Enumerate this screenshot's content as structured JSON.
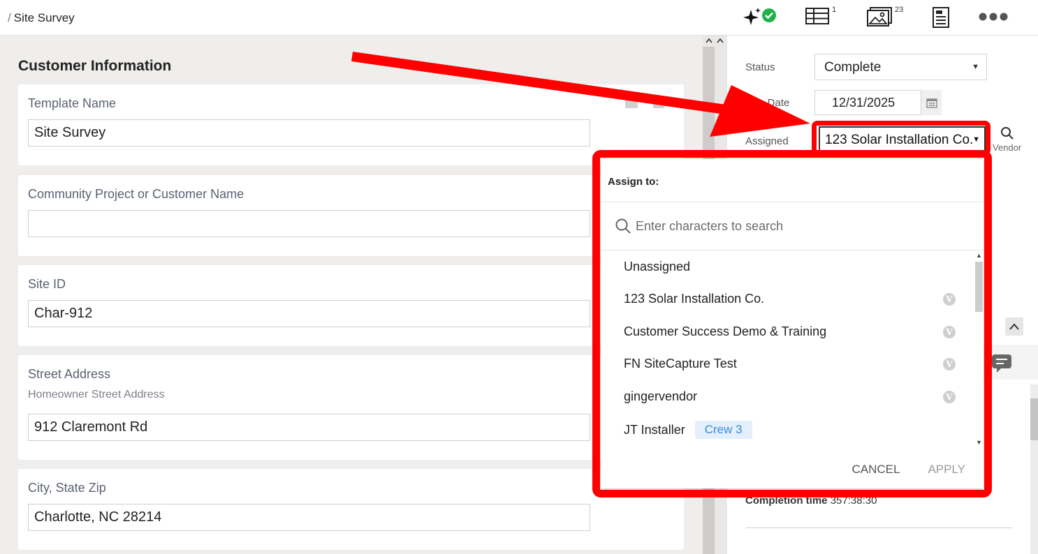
{
  "topbar": {
    "breadcrumb_sep": "/",
    "breadcrumb": "Site Survey",
    "tables_count": "1",
    "photos_count": "23"
  },
  "form": {
    "section_title": "Customer Information",
    "fields": [
      {
        "label": "Template Name",
        "value": "Site Survey"
      },
      {
        "label": "Community Project or Customer Name",
        "value": ""
      },
      {
        "label": "Site ID",
        "value": "Char-912"
      },
      {
        "label": "Street Address",
        "sublabel": "Homeowner Street Address",
        "value": "912 Claremont Rd"
      },
      {
        "label": "City, State Zip",
        "value": "Charlotte, NC 28214"
      }
    ]
  },
  "details": {
    "status_label": "Status",
    "status_value": "Complete",
    "due_date_label": "Due Date",
    "due_date_value": "12/31/2025",
    "assigned_label": "Assigned",
    "assigned_value": "123 Solar Installation Co.",
    "vendor_label": "Vendor",
    "completion_label": "Completion time",
    "completion_value": "357:38:30"
  },
  "assign_dropdown": {
    "title": "Assign to:",
    "search_placeholder": "Enter characters to search",
    "items": [
      {
        "name": "Unassigned"
      },
      {
        "name": "123 Solar Installation Co.",
        "badge": "V"
      },
      {
        "name": "Customer Success Demo & Training",
        "badge": "V"
      },
      {
        "name": "FN SiteCapture Test",
        "badge": "V"
      },
      {
        "name": "gingervendor",
        "badge": "V"
      },
      {
        "name": "JT Installer",
        "tag": "Crew 3"
      }
    ],
    "cancel_label": "CANCEL",
    "apply_label": "APPLY"
  },
  "colors": {
    "annotation_red": "#ff0000",
    "ai_check_green": "#21b14b",
    "crew_tag_bg": "#e3effb",
    "crew_tag_text": "#3a8ad6",
    "panel_bg": "#efeeec"
  },
  "icons": [
    "sparkle-icon",
    "check-circle-icon",
    "table-icon",
    "photo-gallery-icon",
    "report-icon",
    "more-icon",
    "calendar-icon",
    "search-icon",
    "chat-icon",
    "chevron-up-icon"
  ]
}
